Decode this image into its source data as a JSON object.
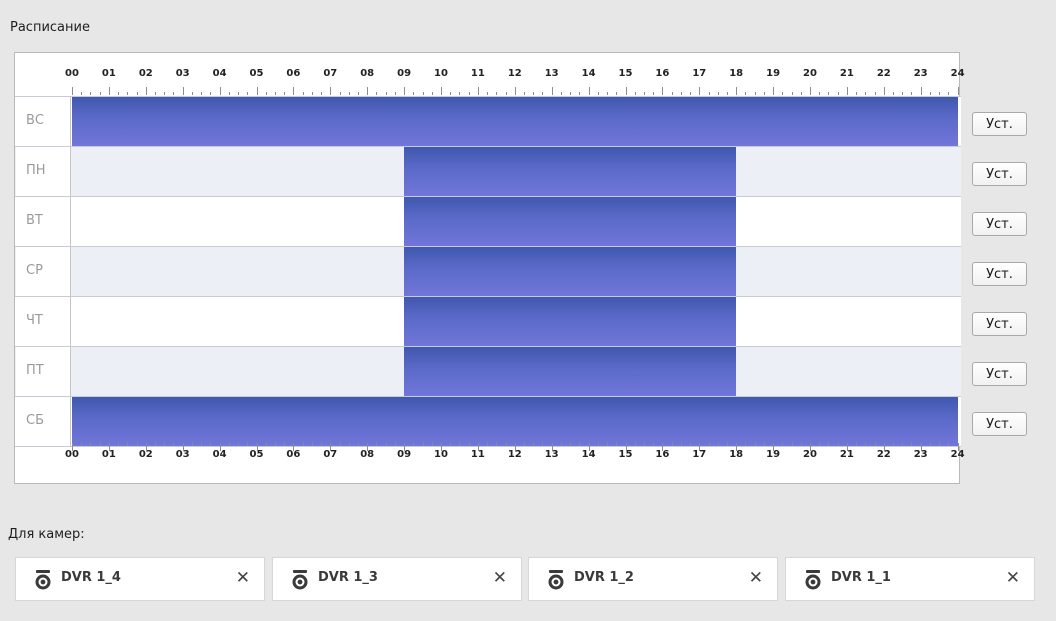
{
  "schedule": {
    "title": "Расписание",
    "hours": [
      "00",
      "01",
      "02",
      "03",
      "04",
      "05",
      "06",
      "07",
      "08",
      "09",
      "10",
      "11",
      "12",
      "13",
      "14",
      "15",
      "16",
      "17",
      "18",
      "19",
      "20",
      "21",
      "22",
      "23",
      "24"
    ],
    "set_button_label": "Уст.",
    "rows": [
      {
        "day": "ВС",
        "blocks": [
          [
            0,
            24
          ]
        ]
      },
      {
        "day": "ПН",
        "blocks": [
          [
            9,
            18
          ]
        ]
      },
      {
        "day": "ВТ",
        "blocks": [
          [
            9,
            18
          ]
        ]
      },
      {
        "day": "СР",
        "blocks": [
          [
            9,
            18
          ]
        ]
      },
      {
        "day": "ЧТ",
        "blocks": [
          [
            9,
            18
          ]
        ]
      },
      {
        "day": "ПТ",
        "blocks": [
          [
            9,
            18
          ]
        ]
      },
      {
        "day": "СБ",
        "blocks": [
          [
            0,
            24
          ]
        ]
      }
    ],
    "block_color": "#5b6ac9"
  },
  "cameras": {
    "title": "Для камер:",
    "items": [
      {
        "name": "DVR 1_4",
        "icon": "camera-icon",
        "close_label": "✕"
      },
      {
        "name": "DVR 1_3",
        "icon": "camera-icon",
        "close_label": "✕"
      },
      {
        "name": "DVR 1_2",
        "icon": "camera-icon",
        "close_label": "✕"
      },
      {
        "name": "DVR 1_1",
        "icon": "camera-icon",
        "close_label": "✕"
      }
    ]
  }
}
